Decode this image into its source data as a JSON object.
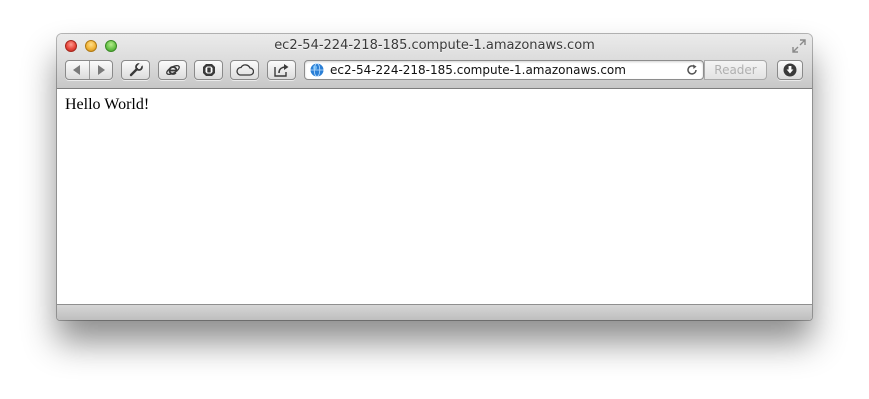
{
  "window": {
    "title": "ec2-54-224-218-185.compute-1.amazonaws.com"
  },
  "toolbar": {
    "buttons": [
      {
        "name": "back",
        "icon": "back-arrow-icon"
      },
      {
        "name": "forward",
        "icon": "forward-arrow-icon"
      },
      {
        "name": "develop",
        "icon": "wrench-icon"
      },
      {
        "name": "internet-explorer",
        "icon": "ie-icon"
      },
      {
        "name": "adblock",
        "icon": "shield-icon"
      },
      {
        "name": "icloud",
        "icon": "cloud-icon"
      },
      {
        "name": "share",
        "icon": "share-icon"
      },
      {
        "name": "downloads",
        "icon": "download-icon"
      }
    ],
    "reader_label": "Reader"
  },
  "address_bar": {
    "url": "ec2-54-224-218-185.compute-1.amazonaws.com",
    "site_icon": "globe-icon",
    "reload_icon": "reload-icon"
  },
  "page": {
    "text": "Hello World!"
  },
  "colors": {
    "close": "#e8473c",
    "minimize": "#f2b53a",
    "maximize": "#6ac44a",
    "reader_disabled": "#b0b0b0",
    "globe": "#2a7fd6"
  }
}
